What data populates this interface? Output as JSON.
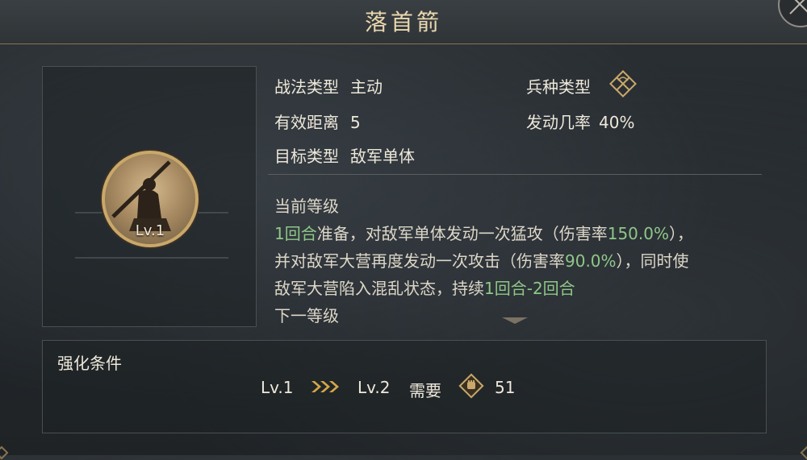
{
  "title": "落首箭",
  "skill": {
    "level": "Lv.1"
  },
  "stats": {
    "skill_type": {
      "label": "战法类型",
      "value": "主动"
    },
    "range": {
      "label": "有效距离",
      "value": "5"
    },
    "target": {
      "label": "目标类型",
      "value": "敌军单体"
    },
    "troop_type": {
      "label": "兵种类型",
      "icon": "crossed-bow-icon"
    },
    "trigger_rate": {
      "label": "发动几率",
      "value": "40%"
    }
  },
  "description": {
    "current_level_label": "当前等级",
    "line1": {
      "a": "1回合",
      "b": "准备，对敌军单体发动一次猛攻（伤害率",
      "c": "150.0%",
      "d": "），"
    },
    "line2": {
      "a": "并对敌军大营再度发动一次攻击（伤害率",
      "b": "90.0%",
      "c": "），同时使"
    },
    "line3": {
      "a": "敌军大营陷入混乱状态，持续",
      "b": "1回合-2回合"
    },
    "next_level_label": "下一等级"
  },
  "upgrade": {
    "title": "强化条件",
    "from_level": "Lv.1",
    "to_level": "Lv.2",
    "require_label": "需要",
    "cost": "51",
    "cost_icon": "fist-token-icon"
  },
  "colors": {
    "gold": "#c9a86a",
    "highlight_green": "#8fc788",
    "text": "#eee8da"
  }
}
